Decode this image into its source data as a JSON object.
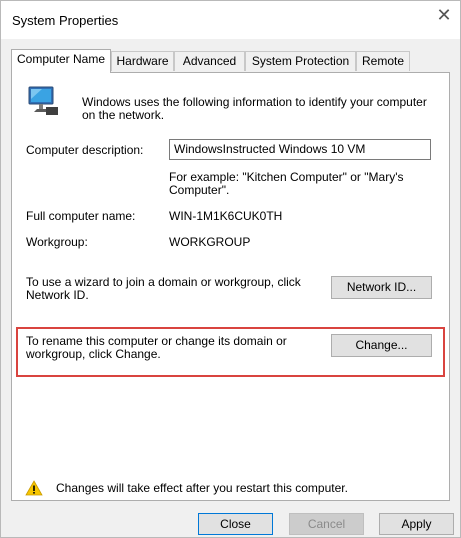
{
  "window": {
    "title": "System Properties",
    "close_glyph": "✕"
  },
  "tabs": [
    {
      "label": "Computer Name",
      "active": true
    },
    {
      "label": "Hardware",
      "active": false
    },
    {
      "label": "Advanced",
      "active": false
    },
    {
      "label": "System Protection",
      "active": false
    },
    {
      "label": "Remote",
      "active": false
    }
  ],
  "info": {
    "icon": "computer-monitor-icon",
    "text": "Windows uses the following information to identify your computer on the network."
  },
  "description": {
    "label": "Computer description:",
    "value": "WindowsInstructed Windows 10 VM",
    "example": "For example: \"Kitchen Computer\" or \"Mary's Computer\"."
  },
  "full_name": {
    "label": "Full computer name:",
    "value": "WIN-1M1K6CUK0TH"
  },
  "workgroup": {
    "label": "Workgroup:",
    "value": "WORKGROUP"
  },
  "network": {
    "text": "To use a wizard to join a domain or workgroup, click Network ID.",
    "button": "Network ID..."
  },
  "rename": {
    "text": "To rename this computer or change its domain or workgroup, click Change.",
    "button": "Change...",
    "highlight_color": "#d9443f"
  },
  "warning": {
    "icon": "warning-icon",
    "text": "Changes will take effect after you restart this computer."
  },
  "buttons": {
    "close": "Close",
    "cancel": "Cancel",
    "apply": "Apply"
  }
}
